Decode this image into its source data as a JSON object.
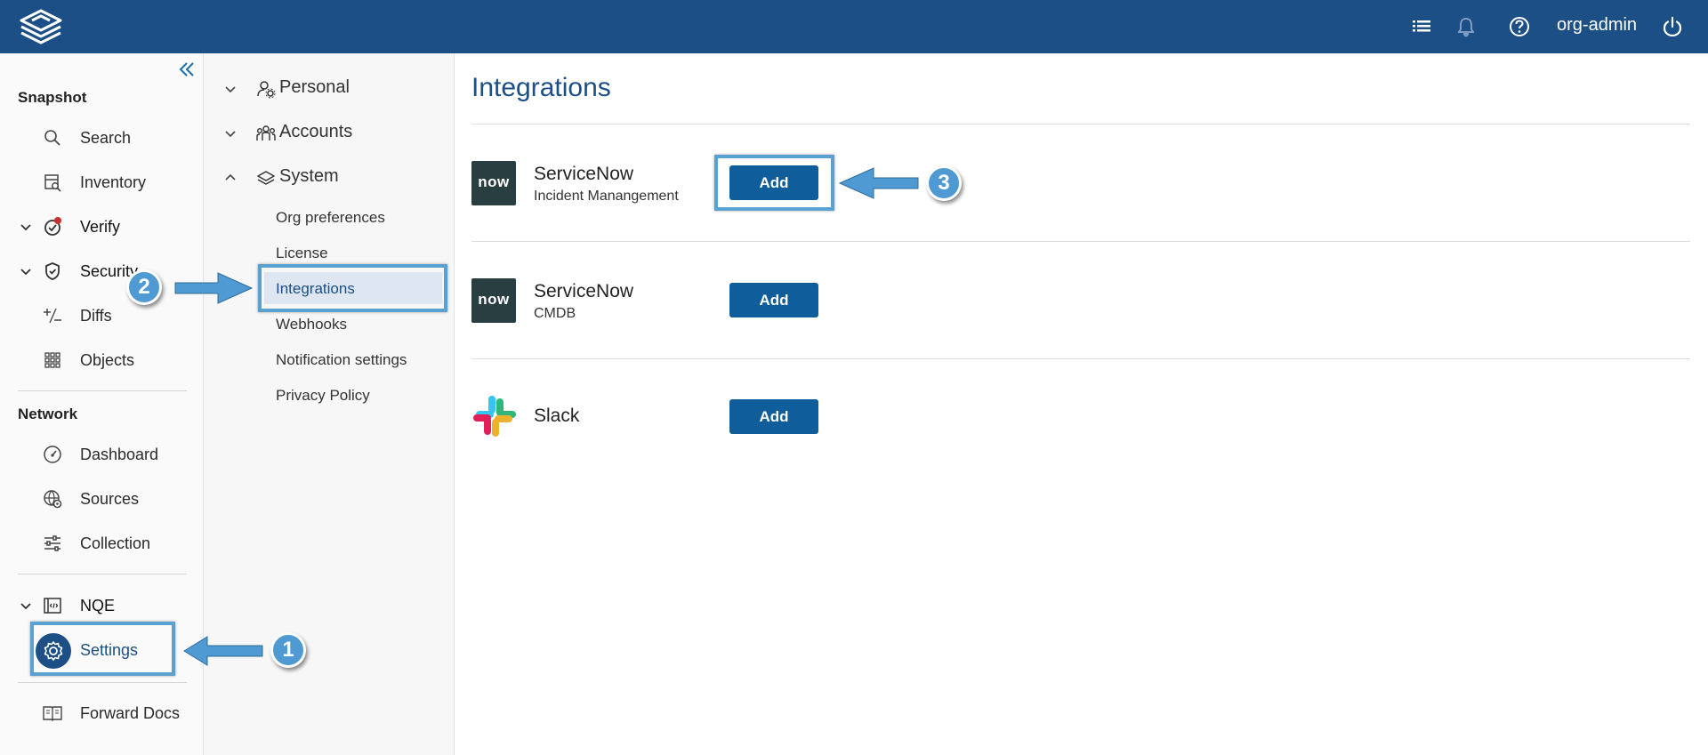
{
  "topbar": {
    "user_label": "org-admin",
    "icons": [
      "logo-icon",
      "list-icon",
      "bell-icon",
      "help-icon",
      "power-icon"
    ],
    "colors": {
      "background": "#1b4f85"
    }
  },
  "left_nav": {
    "sections": [
      {
        "title": "Snapshot",
        "items": [
          {
            "label": "Search",
            "icon": "search-icon"
          },
          {
            "label": "Inventory",
            "icon": "inventory-icon"
          },
          {
            "label": "Verify",
            "icon": "verify-icon",
            "expandable": true
          },
          {
            "label": "Security",
            "icon": "shield-icon",
            "expandable": true
          },
          {
            "label": "Diffs",
            "icon": "diffs-icon"
          },
          {
            "label": "Objects",
            "icon": "grid-icon"
          }
        ]
      },
      {
        "title": "Network",
        "items": [
          {
            "label": "Dashboard",
            "icon": "gauge-icon"
          },
          {
            "label": "Sources",
            "icon": "sources-icon"
          },
          {
            "label": "Collection",
            "icon": "sliders-icon"
          }
        ]
      }
    ],
    "nqe_label": "NQE",
    "settings_label": "Settings",
    "docs_label": "Forward Docs"
  },
  "settings_nav": {
    "groups": [
      {
        "label": "Personal",
        "icon": "user-gear-icon",
        "expanded": false
      },
      {
        "label": "Accounts",
        "icon": "group-icon",
        "expanded": false
      },
      {
        "label": "System",
        "icon": "layers-icon",
        "expanded": true
      }
    ],
    "system_items": [
      "Org preferences",
      "License",
      "Integrations",
      "Webhooks",
      "Notification settings",
      "Privacy Policy"
    ],
    "active_item": "Integrations"
  },
  "main": {
    "title": "Integrations",
    "integrations": [
      {
        "name": "ServiceNow",
        "subtitle": "Incident Manangement",
        "logo_text": "now",
        "button": "Add"
      },
      {
        "name": "ServiceNow",
        "subtitle": "CMDB",
        "logo_text": "now",
        "button": "Add"
      },
      {
        "name": "Slack",
        "subtitle": "",
        "button": "Add"
      }
    ]
  },
  "annotations": {
    "steps": [
      "1",
      "2",
      "3"
    ],
    "color": "#4f9ad2"
  }
}
